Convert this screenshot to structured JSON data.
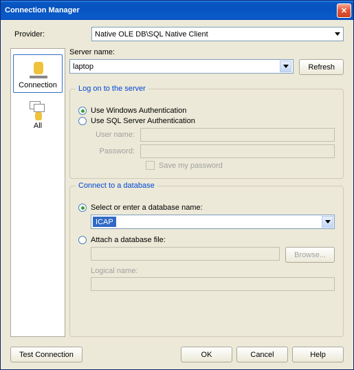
{
  "title": "Connection Manager",
  "provider_label": "Provider:",
  "provider_value": "Native OLE DB\\SQL Native Client",
  "sidebar": {
    "connection": "Connection",
    "all": "All"
  },
  "server_name_label": "Server name:",
  "server_name_value": "laptop",
  "refresh": "Refresh",
  "group_logon": "Log on to the server",
  "auth_windows": "Use Windows Authentication",
  "auth_sql": "Use SQL Server Authentication",
  "user_label": "User name:",
  "pass_label": "Password:",
  "save_pass": "Save my password",
  "group_db": "Connect to a database",
  "db_select_label": "Select or enter a database name:",
  "db_value": "ICAP",
  "db_attach_label": "Attach a database file:",
  "browse": "Browse...",
  "logical_label": "Logical name:",
  "test": "Test Connection",
  "ok": "OK",
  "cancel": "Cancel",
  "help": "Help"
}
